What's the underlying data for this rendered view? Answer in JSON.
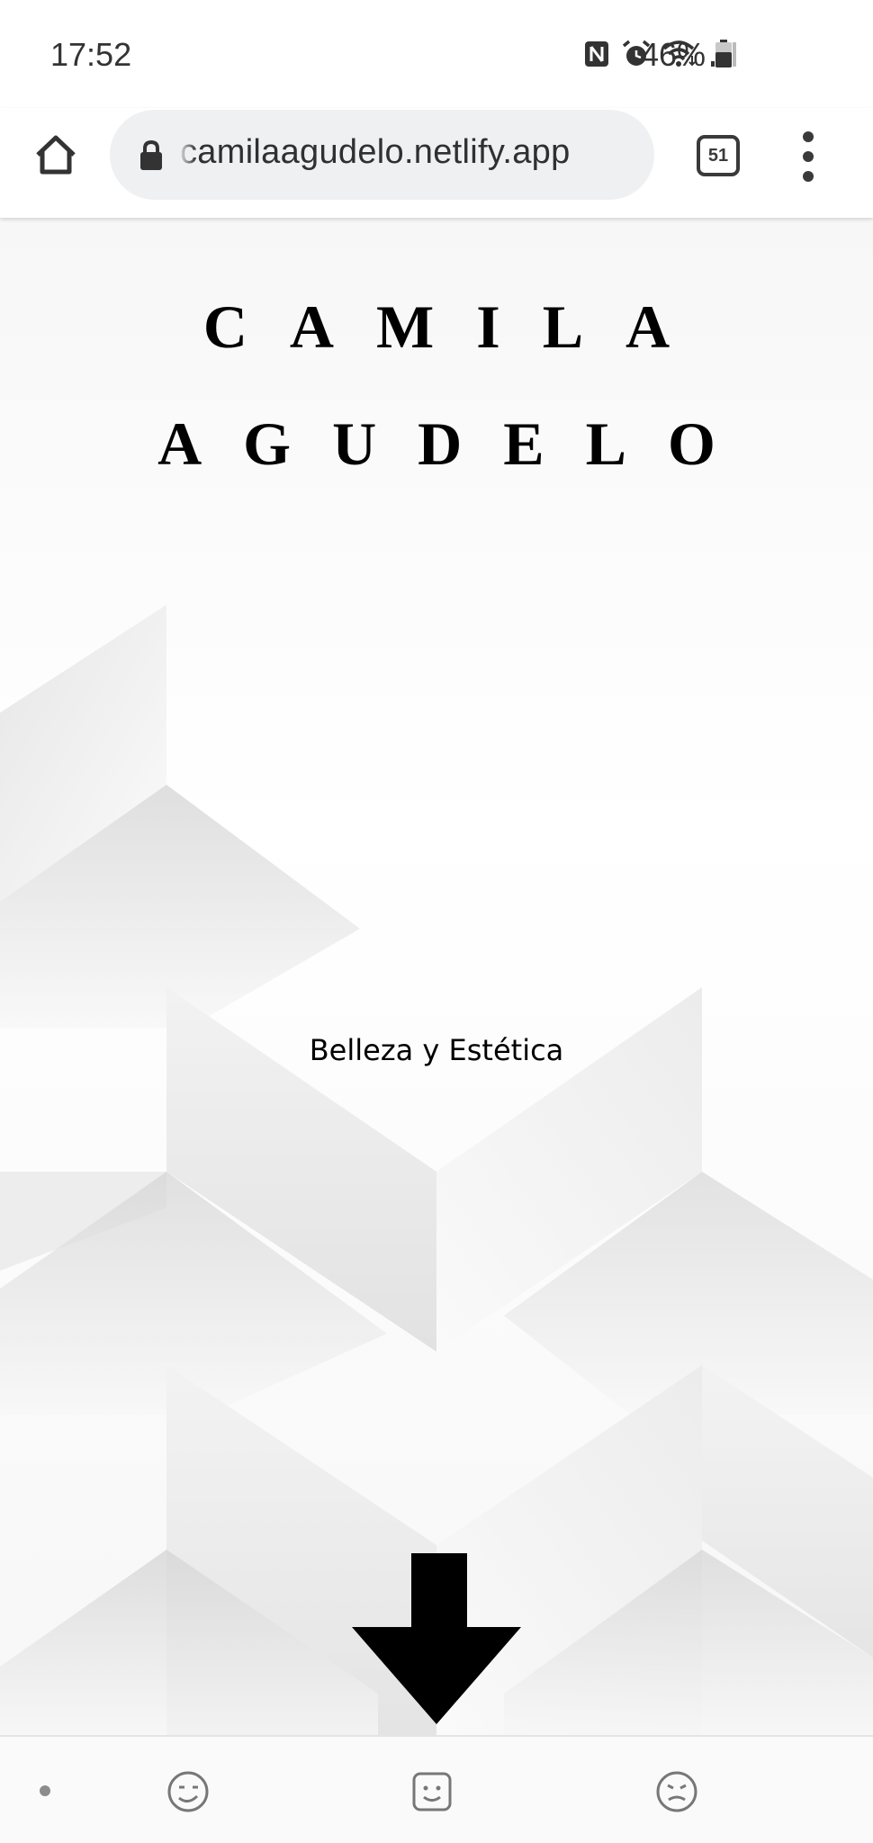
{
  "status_bar": {
    "time": "17:52",
    "battery": "46%",
    "icons": [
      "nfc-icon",
      "alarm-icon",
      "wifi-icon",
      "signal-icon",
      "battery-icon"
    ]
  },
  "browser": {
    "url": "camilaagudelo.netlify.app",
    "tab_count": "51",
    "icons": [
      "home-icon",
      "lock-icon",
      "tabs-icon",
      "menu-icon"
    ]
  },
  "page": {
    "title_line1": "CAMILA",
    "title_line2": "AGUDELO",
    "tagline": "Belleza y Estética",
    "scroll_icon": "down-arrow-icon"
  },
  "bottom_strip": {
    "icons": [
      "dot-icon",
      "emoji-icon",
      "sticker-icon",
      "emoji-alt-icon"
    ]
  }
}
